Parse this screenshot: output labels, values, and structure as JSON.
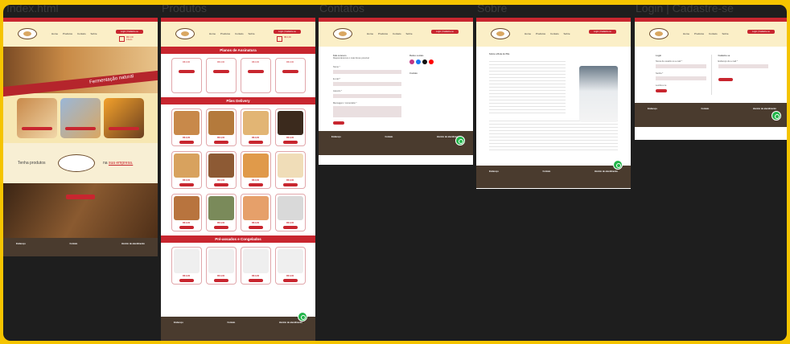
{
  "frames": {
    "index": {
      "title": "Index.html"
    },
    "produtos": {
      "title": "Produtos"
    },
    "contatos": {
      "title": "Contatos"
    },
    "sobre": {
      "title": "Sobre"
    },
    "login": {
      "title": "Login | Cadastre-se"
    }
  },
  "header": {
    "nav": [
      "Home",
      "Produtos",
      "Contato",
      "Sobre"
    ],
    "login_button": "Login | Cadastre-se",
    "cart_price": "R$ 0,00",
    "cart_items": "0 itens"
  },
  "index": {
    "hero_text": "Fermentação natural",
    "promo_text_1": "Tenha produtos",
    "promo_text_2": "na",
    "promo_link": "sua empresa.",
    "bakery_button": "Conheça o Pão"
  },
  "produtos": {
    "section_plans": "Planos de Assinatura",
    "section_delivery": "Pães Delivery",
    "section_frozen": "Pré-assados e Congelados",
    "price": "R$ 0,00"
  },
  "contatos": {
    "form_title": "Fale conosco",
    "form_subtitle": "Responderemos o mais breve possível",
    "name_label": "Nome *",
    "email_label": "E-mail *",
    "subject_label": "Assunto *",
    "message_label": "Mensagem / comentário *",
    "social_title": "Redes sociais",
    "contact_title": "Contato"
  },
  "sobre": {
    "title": "Sobre a Rota do Pão"
  },
  "login": {
    "login_title": "Login",
    "register_title": "Cadastre-se",
    "email_label": "Nome de usuário ou e-mail *",
    "password_label": "Senha *",
    "remember_label": "Lembre-me",
    "login_button": "Acessar",
    "register_email_label": "Endereço de e-mail *",
    "register_button": "Cadastre-se"
  },
  "footer": {
    "address_title": "Endereço",
    "contact_title": "Contato",
    "hours_title": "Horário de atendimento"
  },
  "colors": {
    "accent": "#c8262f",
    "cream": "#fbefc7",
    "footer": "#4a3b2e",
    "whatsapp": "#22b54a",
    "frame_border": "#f5c400"
  }
}
